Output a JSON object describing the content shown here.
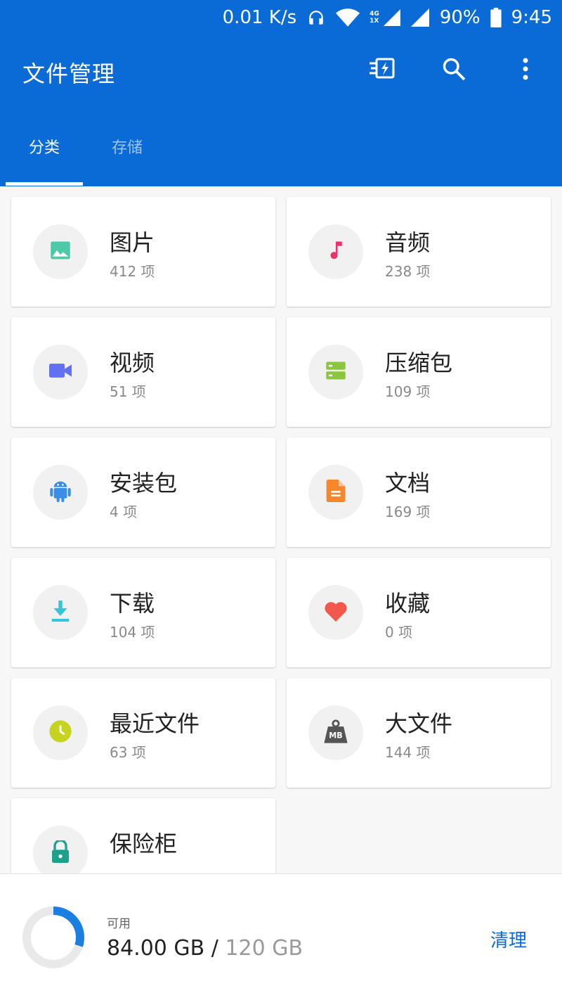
{
  "status_bar": {
    "speed": "0.01 K/s",
    "net_top": "4G",
    "net_bottom": "1X",
    "battery": "90%",
    "time": "9:45"
  },
  "app_bar": {
    "title": "文件管理",
    "actions": [
      "flash-transfer-icon",
      "search-icon",
      "more-vert-icon"
    ]
  },
  "tabs": [
    {
      "label": "分类",
      "active": true
    },
    {
      "label": "存储",
      "active": false
    }
  ],
  "categories": [
    {
      "name": "图片",
      "count": "412 项",
      "icon": "image-icon",
      "color": "#4cc9a6"
    },
    {
      "name": "音频",
      "count": "238 项",
      "icon": "music-note-icon",
      "color": "#e8336c"
    },
    {
      "name": "视频",
      "count": "51 项",
      "icon": "video-camera-icon",
      "color": "#6271f2"
    },
    {
      "name": "压缩包",
      "count": "109 项",
      "icon": "archive-icon",
      "color": "#8cc63f"
    },
    {
      "name": "安装包",
      "count": "4 项",
      "icon": "android-icon",
      "color": "#3b8ee8"
    },
    {
      "name": "文档",
      "count": "169 项",
      "icon": "document-icon",
      "color": "#f6872d"
    },
    {
      "name": "下载",
      "count": "104 项",
      "icon": "download-icon",
      "color": "#35c5d8"
    },
    {
      "name": "收藏",
      "count": "0 项",
      "icon": "heart-icon",
      "color": "#f2584c"
    },
    {
      "name": "最近文件",
      "count": "63 项",
      "icon": "clock-icon",
      "color": "#c6d41f"
    },
    {
      "name": "大文件",
      "count": "144 项",
      "icon": "weight-icon",
      "color": "#555555"
    },
    {
      "name": "保险柜",
      "count": "",
      "icon": "lock-icon",
      "color": "#1fa08a"
    }
  ],
  "storage": {
    "label": "可用",
    "available": "84.00 GB",
    "separator": " / ",
    "total": "120 GB",
    "used_fraction": 0.3,
    "ring_color": "#1a7fe0",
    "clean_label": "清理"
  }
}
